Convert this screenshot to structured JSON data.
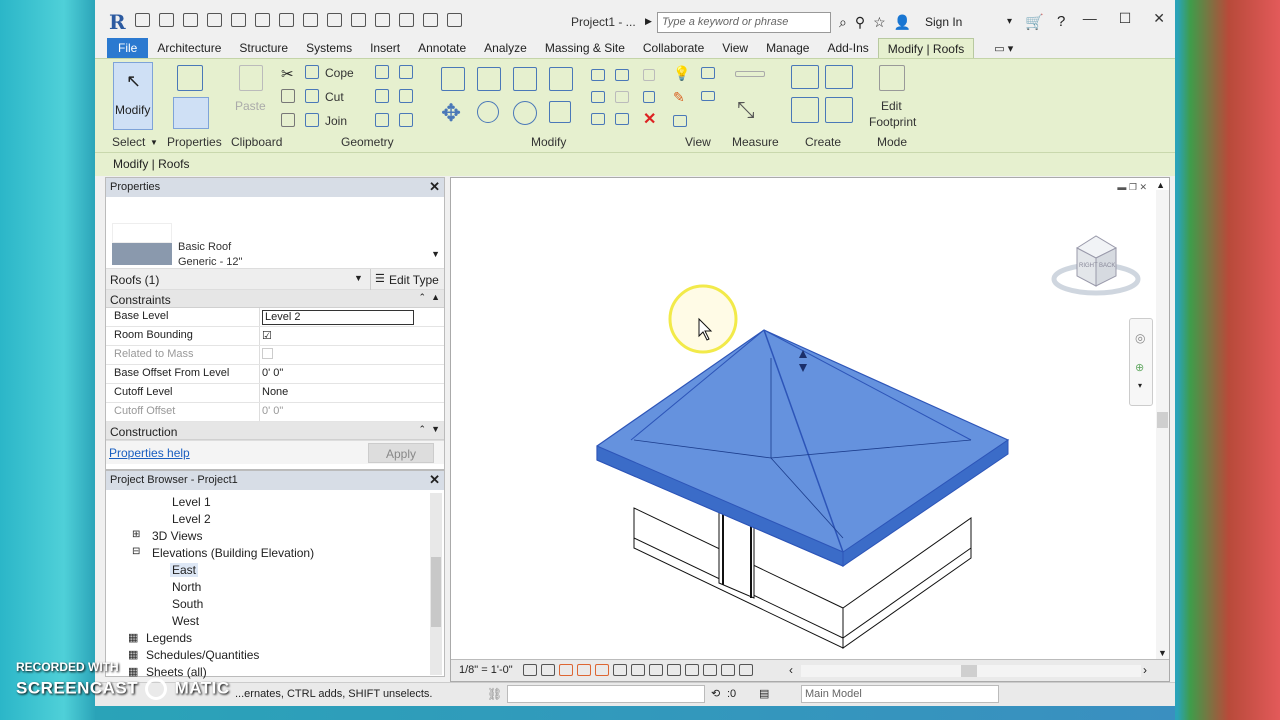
{
  "app": {
    "logo": "R",
    "title": "Project1 - ...",
    "search_placeholder": "Type a keyword or phrase",
    "sign_in": "Sign In"
  },
  "tabs": [
    "File",
    "Architecture",
    "Structure",
    "Systems",
    "Insert",
    "Annotate",
    "Analyze",
    "Massing & Site",
    "Collaborate",
    "View",
    "Manage",
    "Add-Ins",
    "Modify | Roofs"
  ],
  "ribbon": {
    "select_label": "Modify",
    "panels": {
      "select": "Select",
      "properties": "Properties",
      "clipboard": "Clipboard",
      "geometry": "Geometry",
      "modify": "Modify",
      "view": "View",
      "measure": "Measure",
      "create": "Create",
      "mode": "Mode"
    },
    "paste": "Paste",
    "cope": "Cope",
    "cut": "Cut",
    "join": "Join",
    "edit_footprint": [
      "Edit",
      "Footprint"
    ]
  },
  "context_bar": "Modify | Roofs",
  "properties": {
    "header": "Properties",
    "type_name_1": "Basic Roof",
    "type_name_2": "Generic - 12\"",
    "instance": "Roofs (1)",
    "edit_type": "Edit Type",
    "group_constraints": "Constraints",
    "rows": [
      {
        "key": "Base Level",
        "value": "Level 2"
      },
      {
        "key": "Room Bounding",
        "value": "☑"
      },
      {
        "key": "Related to Mass",
        "value": ""
      },
      {
        "key": "Base Offset From Level",
        "value": "0'  0\""
      },
      {
        "key": "Cutoff Level",
        "value": "None"
      },
      {
        "key": "Cutoff Offset",
        "value": "0'  0\""
      }
    ],
    "group_construction": "Construction",
    "help": "Properties help",
    "apply": "Apply"
  },
  "browser": {
    "header": "Project Browser - Project1",
    "items": [
      "Level 1",
      "Level 2",
      "3D Views",
      "Elevations (Building Elevation)",
      "East",
      "North",
      "South",
      "West",
      "Legends",
      "Schedules/Quantities",
      "Sheets (all)"
    ]
  },
  "viewcube": {
    "right": "RIGHT",
    "back": "BACK"
  },
  "view": {
    "scale": "1/8\" = 1'-0\""
  },
  "status": {
    "hint": "...ernates, CTRL adds, SHIFT unselects.",
    "zero": ":0",
    "model": "Main Model"
  },
  "watermark": {
    "line1": "RECORDED WITH",
    "line2": "SCREENCAST",
    "line3": "MATIC"
  },
  "colors": {
    "roof": "#4a7fd8",
    "ribbon": "#e6f0cf",
    "file_tab": "#2b79d0"
  }
}
